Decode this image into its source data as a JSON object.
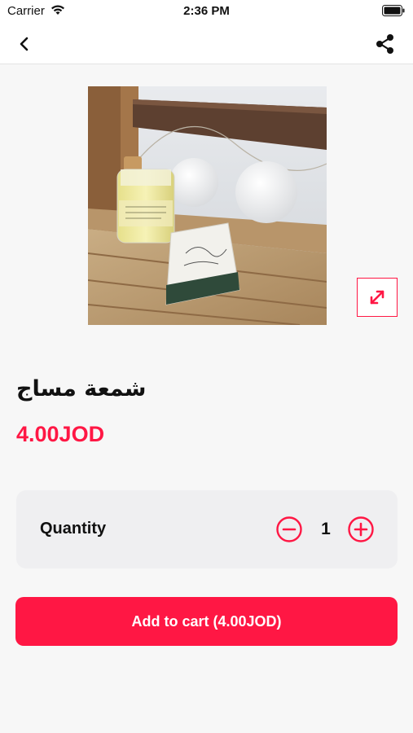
{
  "status_bar": {
    "carrier": "Carrier",
    "time": "2:36 PM"
  },
  "nav": {
    "back_icon": "chevron-left-icon",
    "share_icon": "share-icon"
  },
  "product": {
    "title": "شمعة مساج",
    "price": "4.00JOD",
    "image_icon": "product-photo",
    "expand_icon": "expand-icon"
  },
  "quantity": {
    "label": "Quantity",
    "value": "1"
  },
  "cart": {
    "button_label": "Add to cart (4.00JOD)"
  },
  "colors": {
    "accent": "#ff1744",
    "background": "#f7f7f7",
    "card": "#efeff1"
  }
}
